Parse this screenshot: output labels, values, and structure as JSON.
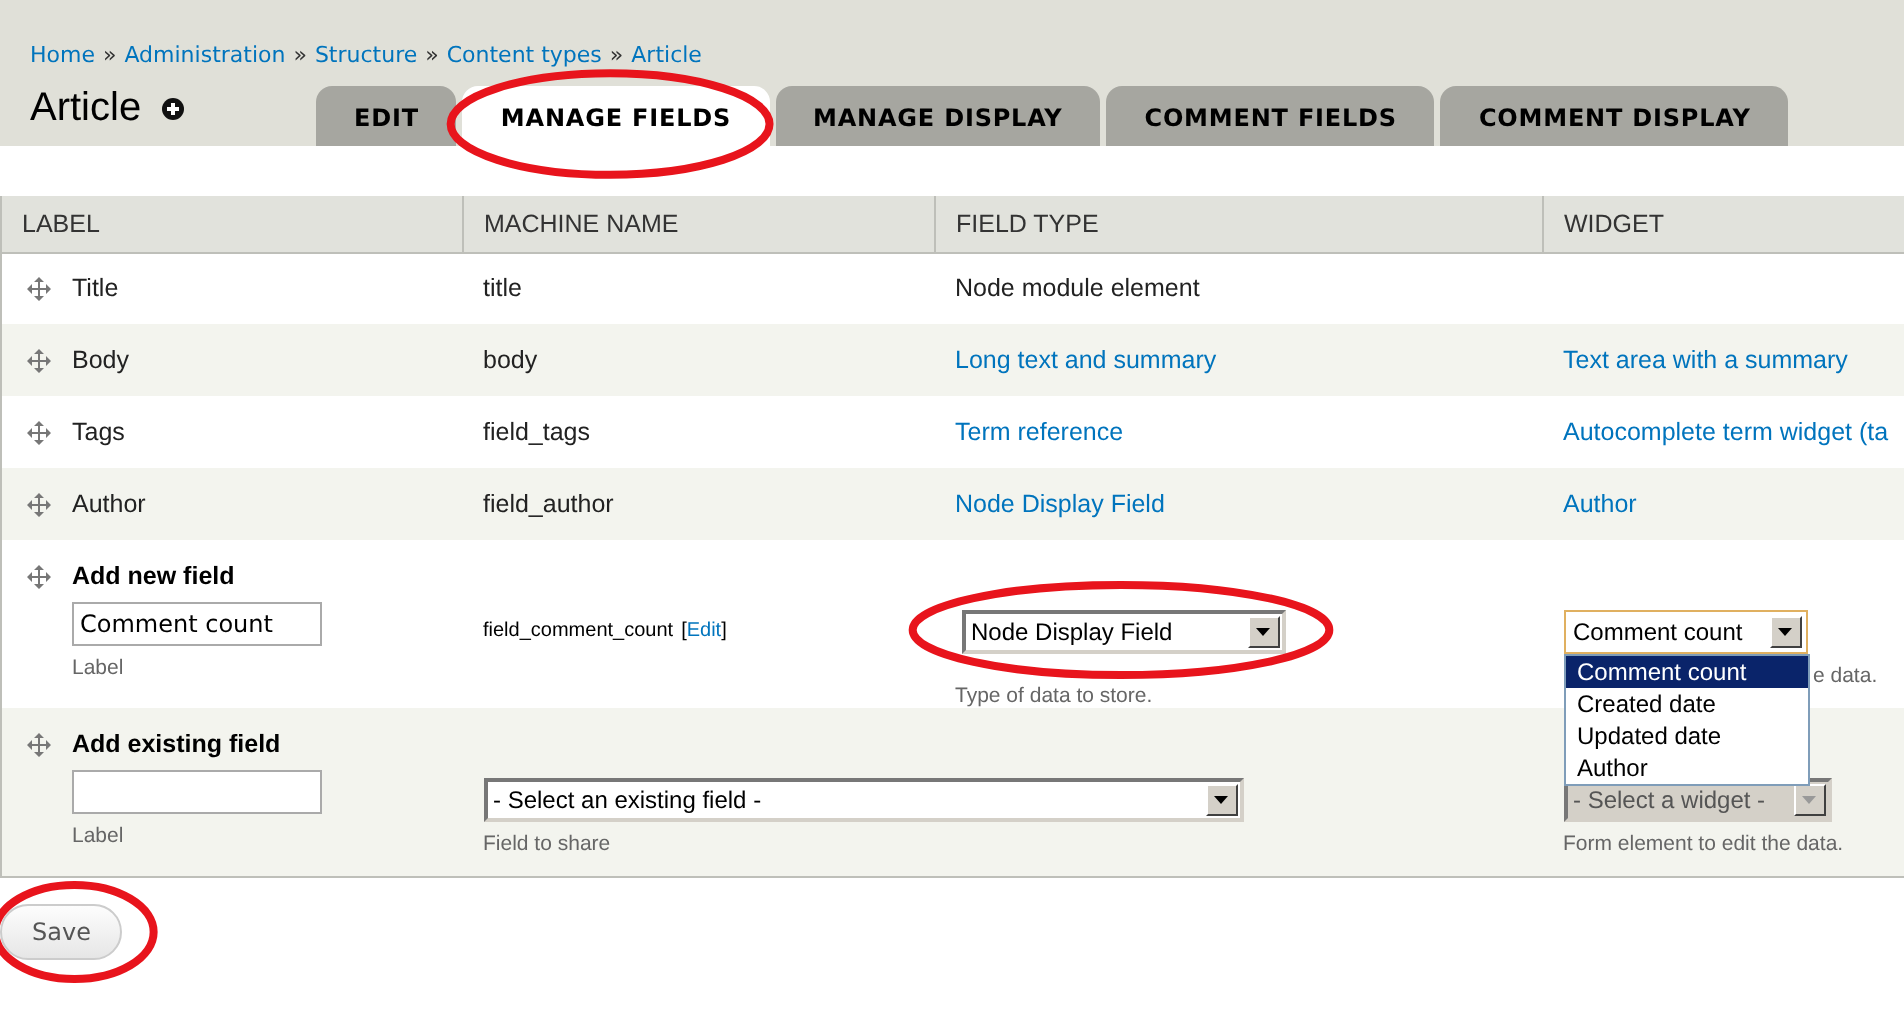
{
  "breadcrumb": {
    "separator": "»",
    "items": [
      {
        "label": "Home"
      },
      {
        "label": "Administration"
      },
      {
        "label": "Structure"
      },
      {
        "label": "Content types"
      },
      {
        "label": "Article"
      }
    ]
  },
  "page_title": "Article",
  "tabs": [
    {
      "label": "EDIT",
      "selected": false,
      "highlighted": false
    },
    {
      "label": "MANAGE FIELDS",
      "selected": true,
      "highlighted": true
    },
    {
      "label": "MANAGE DISPLAY",
      "selected": false,
      "highlighted": false
    },
    {
      "label": "COMMENT FIELDS",
      "selected": false,
      "highlighted": false
    },
    {
      "label": "COMMENT DISPLAY",
      "selected": false,
      "highlighted": false
    }
  ],
  "table": {
    "columns": [
      "LABEL",
      "MACHINE NAME",
      "FIELD TYPE",
      "WIDGET"
    ],
    "rows": [
      {
        "label": "Title",
        "machine_name": "title",
        "field_type": {
          "text": "Node module element",
          "link": false
        }
      },
      {
        "label": "Body",
        "machine_name": "body",
        "field_type": {
          "text": "Long text and summary",
          "link": true
        },
        "widget": {
          "text": "Text area with a summary",
          "link": true
        }
      },
      {
        "label": "Tags",
        "machine_name": "field_tags",
        "field_type": {
          "text": "Term reference",
          "link": true
        },
        "widget": {
          "text": "Autocomplete term widget (ta",
          "link": true
        }
      },
      {
        "label": "Author",
        "machine_name": "field_author",
        "field_type": {
          "text": "Node Display Field",
          "link": true
        },
        "widget": {
          "text": "Author",
          "link": true
        }
      }
    ]
  },
  "add_new_field": {
    "title": "Add new field",
    "label_input": {
      "value": "Comment count",
      "caption": "Label"
    },
    "machine_name": "field_comment_count",
    "edit_link": {
      "open": "[",
      "label": "Edit",
      "close": "]"
    },
    "field_type": {
      "value": "Node Display Field",
      "caption": "Type of data to store.",
      "highlighted": true
    },
    "widget": {
      "value": "Comment count",
      "caption": "e data.",
      "expanded": true,
      "disabled": false,
      "options": [
        {
          "label": "Comment count",
          "selected": true
        },
        {
          "label": "Created date",
          "selected": false
        },
        {
          "label": "Updated date",
          "selected": false
        },
        {
          "label": "Author",
          "selected": false
        }
      ]
    }
  },
  "add_existing_field": {
    "title": "Add existing field",
    "label_input": {
      "caption": "Label"
    },
    "field": {
      "value": "- Select an existing field -",
      "caption": "Field to share"
    },
    "widget": {
      "value": "- Select a widget -",
      "caption": "Form element to edit the data.",
      "disabled": true,
      "expanded": false
    }
  },
  "save_button": {
    "label": "Save",
    "highlighted": true
  }
}
